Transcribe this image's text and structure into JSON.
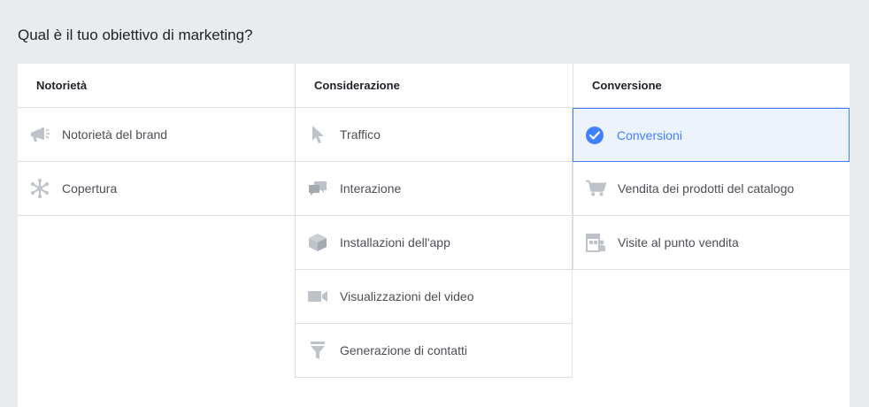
{
  "page": {
    "title": "Qual è il tuo obiettivo di marketing?"
  },
  "colors": {
    "selected_accent": "#4080ff",
    "icon_gray": "#bec3c9",
    "background": "#e9ebee"
  },
  "columns": [
    {
      "header": "Notorietà",
      "items": [
        {
          "label": "Notorietà del brand",
          "icon": "megaphone-icon",
          "selected": false
        },
        {
          "label": "Copertura",
          "icon": "reach-icon",
          "selected": false
        }
      ]
    },
    {
      "header": "Considerazione",
      "items": [
        {
          "label": "Traffico",
          "icon": "cursor-icon",
          "selected": false
        },
        {
          "label": "Interazione",
          "icon": "chat-bubbles-icon",
          "selected": false
        },
        {
          "label": "Installazioni dell'app",
          "icon": "cube-icon",
          "selected": false
        },
        {
          "label": "Visualizzazioni del video",
          "icon": "video-camera-icon",
          "selected": false
        },
        {
          "label": "Generazione di contatti",
          "icon": "funnel-icon",
          "selected": false
        }
      ]
    },
    {
      "header": "Conversione",
      "items": [
        {
          "label": "Conversioni",
          "icon": "checkmark-circle-icon",
          "selected": true
        },
        {
          "label": "Vendita dei prodotti del catalogo",
          "icon": "shopping-cart-icon",
          "selected": false
        },
        {
          "label": "Visite al punto vendita",
          "icon": "store-icon",
          "selected": false
        }
      ]
    }
  ]
}
